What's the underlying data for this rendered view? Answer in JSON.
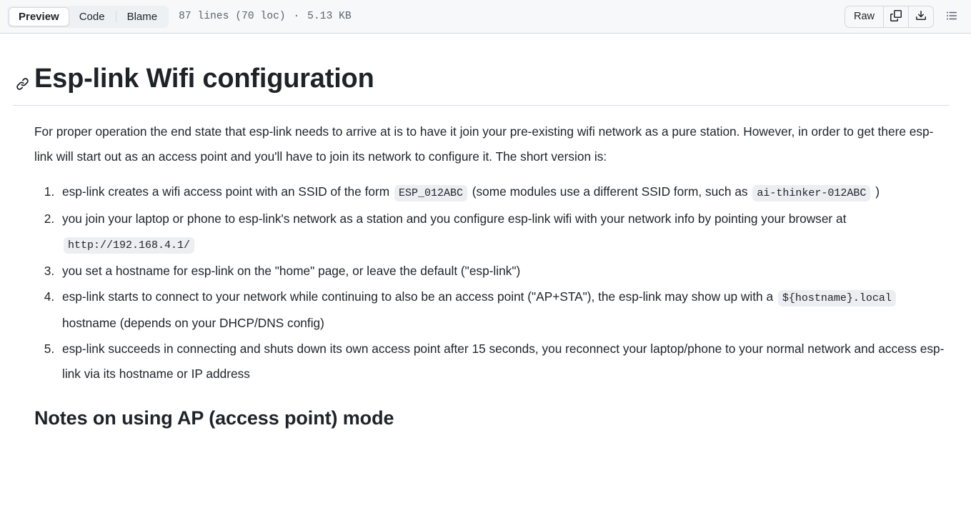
{
  "header": {
    "tabs": [
      {
        "label": "Preview",
        "active": true
      },
      {
        "label": "Code",
        "active": false
      },
      {
        "label": "Blame",
        "active": false
      }
    ],
    "file_meta": {
      "lines": "87 lines (70 loc)",
      "separator": "·",
      "size": "5.13 KB"
    },
    "actions": {
      "raw_label": "Raw",
      "copy_icon": "copy-icon",
      "download_icon": "download-icon",
      "outline_icon": "outline-list-icon"
    },
    "background_color": "#f6f8fa",
    "border_color": "#d1d9e0"
  },
  "document": {
    "anchor_icon": "link-icon",
    "h1": "Esp-link Wifi configuration",
    "intro_paragraph": "For proper operation the end state that esp-link needs to arrive at is to have it join your pre-existing wifi network as a pure station. However, in order to get there esp-link will start out as an access point and you'll have to join its network to configure it. The short version is:",
    "list_items": [
      {
        "parts": [
          {
            "type": "text",
            "value": "esp-link creates a wifi access point with an SSID of the form "
          },
          {
            "type": "code",
            "value": "ESP_012ABC"
          },
          {
            "type": "text",
            "value": " (some modules use a different SSID form, such as "
          },
          {
            "type": "code",
            "value": "ai-thinker-012ABC"
          },
          {
            "type": "text",
            "value": " )"
          }
        ]
      },
      {
        "parts": [
          {
            "type": "text",
            "value": "you join your laptop or phone to esp-link's network as a station and you configure esp-link wifi with your network info by pointing your browser at "
          },
          {
            "type": "code",
            "value": "http://192.168.4.1/"
          }
        ]
      },
      {
        "parts": [
          {
            "type": "text",
            "value": "you set a hostname for esp-link on the \"home\" page, or leave the default (\"esp-link\")"
          }
        ]
      },
      {
        "parts": [
          {
            "type": "text",
            "value": "esp-link starts to connect to your network while continuing to also be an access point (\"AP+STA\"), the esp-link may show up with a "
          },
          {
            "type": "code",
            "value": "${hostname}.local"
          },
          {
            "type": "text",
            "value": " hostname (depends on your DHCP/DNS config)"
          }
        ]
      },
      {
        "parts": [
          {
            "type": "text",
            "value": "esp-link succeeds in connecting and shuts down its own access point after 15 seconds, you reconnect your laptop/phone to your normal network and access esp-link via its hostname or IP address"
          }
        ]
      }
    ],
    "h2": "Notes on using AP (access point) mode",
    "text_color": "#1f2328",
    "code_bg": "#eceef1",
    "rule_color": "#d8dee4"
  }
}
